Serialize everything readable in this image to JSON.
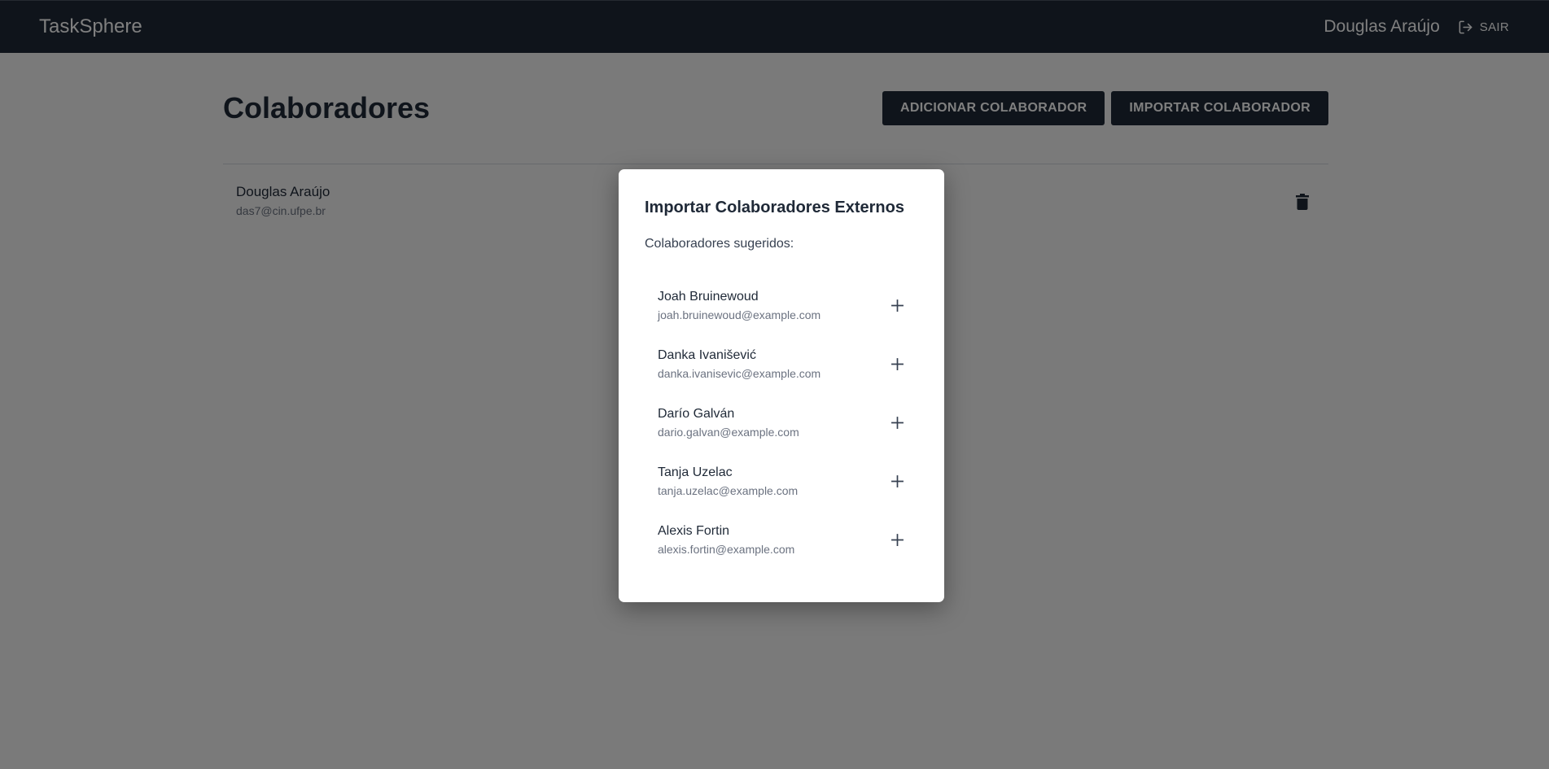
{
  "app": {
    "title": "TaskSphere"
  },
  "header": {
    "user_name": "Douglas Araújo",
    "logout_label": "SAIR"
  },
  "page": {
    "title": "Colaboradores",
    "add_button_label": "ADICIONAR COLABORADOR",
    "import_button_label": "IMPORTAR COLABORADOR"
  },
  "collaborators": [
    {
      "name": "Douglas Araújo",
      "email": "das7@cin.ufpe.br"
    }
  ],
  "modal": {
    "title": "Importar Colaboradores Externos",
    "subtitle": "Colaboradores sugeridos:",
    "suggestions": [
      {
        "name": "Joah Bruinewoud",
        "email": "joah.bruinewoud@example.com"
      },
      {
        "name": "Danka Ivanišević",
        "email": "danka.ivanisevic@example.com"
      },
      {
        "name": "Darío Galván",
        "email": "dario.galvan@example.com"
      },
      {
        "name": "Tanja Uzelac",
        "email": "tanja.uzelac@example.com"
      },
      {
        "name": "Alexis Fortin",
        "email": "alexis.fortin@example.com"
      }
    ]
  },
  "icons": {
    "logout": "logout-icon",
    "delete": "trash-icon",
    "add": "plus-icon"
  },
  "colors": {
    "navbar": "#1f2937",
    "overlay": "rgba(0,0,0,0.5)",
    "modal": "#ffffff"
  }
}
